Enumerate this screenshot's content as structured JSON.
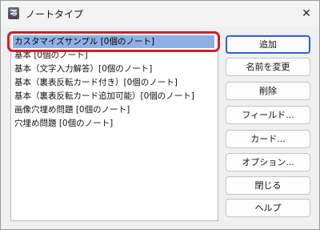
{
  "window": {
    "title": "ノートタイプ",
    "close_symbol": "✕",
    "icon": "app-icon"
  },
  "note_types": [
    "カスタマイズサンプル [0個のノート]",
    "基本 [0個のノート]",
    "基本（文字入力解答）[0個のノート]",
    "基本（裏表反転カード付き）[0個のノート]",
    "基本（裏表反転カード追加可能）[0個のノート]",
    "画像穴埋め問題 [0個のノート]",
    "穴埋め問題 [0個のノート]"
  ],
  "selected_index": 0,
  "buttons": {
    "add": "追加",
    "rename": "名前を変更",
    "delete": "削除",
    "fields": "フィールド...",
    "cards": "カード...",
    "options": "オプション...",
    "close": "閉じる",
    "help": "ヘルプ"
  },
  "colors": {
    "selection": "#8fb0e4",
    "highlight_ring": "#d0202a",
    "primary_border": "#2c63c7"
  }
}
